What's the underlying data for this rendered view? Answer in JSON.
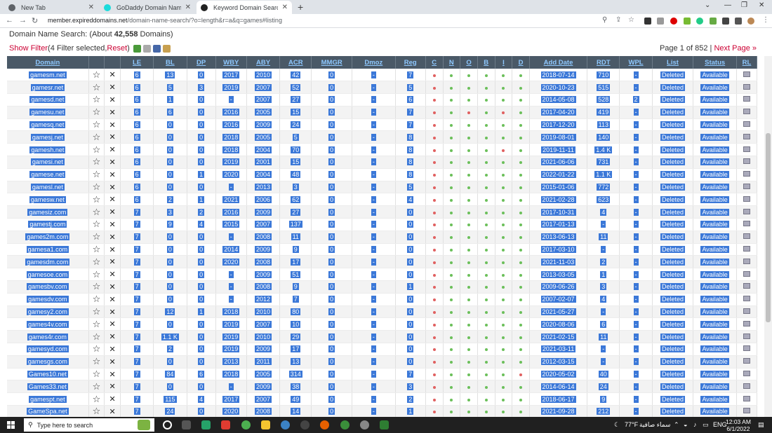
{
  "browser": {
    "tabs": [
      {
        "label": "New Tab",
        "favicon_color": "#5f6368",
        "active": false
      },
      {
        "label": "GoDaddy Domain Name Search",
        "favicon_color": "#1bdbdb",
        "active": false
      },
      {
        "label": "Keyword Domain Search » Expire",
        "favicon_color": "#222222",
        "active": true
      }
    ],
    "url_host": "member.expireddomains.net",
    "url_path": "/domain-name-search/?o=length&r=a&q=games#listing"
  },
  "page": {
    "search_label": "Domain Name Search: (About ",
    "count": "42,558",
    "count_suffix": " Domains)",
    "show_filter": "Show Filter",
    "filters_selected": " (4 Filter selected, ",
    "reset": "Reset",
    "reset_suffix": ")",
    "page_info": "Page 1 of 852 | ",
    "next_page": "Next Page »"
  },
  "table": {
    "headers": [
      "Domain",
      "",
      "",
      "LE",
      "BL",
      "DP",
      "WBY",
      "ABY",
      "ACR",
      "MMGR",
      "Dmoz",
      "Reg",
      "C",
      "N",
      "O",
      "B",
      "I",
      "D",
      "Add Date",
      "RDT",
      "WPL",
      "List",
      "Status",
      "RL"
    ],
    "rows": [
      [
        "gamesm.net",
        "6",
        "13",
        "0",
        "2017",
        "2010",
        "42",
        "0",
        "-",
        "7",
        "r",
        "g",
        "g",
        "g",
        "g",
        "g",
        "2018-07-14",
        "710",
        "-",
        "Deleted",
        "Available"
      ],
      [
        "gamesr.net",
        "6",
        "5",
        "3",
        "2019",
        "2007",
        "52",
        "0",
        "-",
        "5",
        "r",
        "g",
        "g",
        "g",
        "g",
        "g",
        "2020-10-23",
        "515",
        "-",
        "Deleted",
        "Available"
      ],
      [
        "gamesd.net",
        "6",
        "1",
        "0",
        "-",
        "2007",
        "27",
        "0",
        "-",
        "6",
        "r",
        "g",
        "g",
        "g",
        "g",
        "g",
        "2014-05-08",
        "528",
        "2",
        "Deleted",
        "Available"
      ],
      [
        "gamesu.net",
        "6",
        "6",
        "0",
        "2016",
        "2005",
        "15",
        "0",
        "-",
        "7",
        "r",
        "g",
        "r",
        "g",
        "r",
        "g",
        "2017-04-20",
        "419",
        "-",
        "Deleted",
        "Available"
      ],
      [
        "gamesq.net",
        "6",
        "0",
        "0",
        "2016",
        "2009",
        "24",
        "0",
        "-",
        "7",
        "r",
        "g",
        "g",
        "g",
        "g",
        "g",
        "2017-12-20",
        "113",
        "-",
        "Deleted",
        "Available"
      ],
      [
        "gamesj.net",
        "6",
        "0",
        "0",
        "2018",
        "2005",
        "5",
        "0",
        "-",
        "8",
        "r",
        "g",
        "g",
        "g",
        "g",
        "g",
        "2019-08-01",
        "140",
        "-",
        "Deleted",
        "Available"
      ],
      [
        "gamesh.net",
        "6",
        "0",
        "0",
        "2018",
        "2004",
        "70",
        "0",
        "-",
        "8",
        "r",
        "g",
        "g",
        "g",
        "r",
        "g",
        "2019-11-11",
        "1.4 K",
        "-",
        "Deleted",
        "Available"
      ],
      [
        "gamesi.net",
        "6",
        "0",
        "0",
        "2019",
        "2001",
        "15",
        "0",
        "-",
        "8",
        "r",
        "g",
        "g",
        "g",
        "g",
        "g",
        "2021-06-06",
        "731",
        "-",
        "Deleted",
        "Available"
      ],
      [
        "gamese.net",
        "6",
        "0",
        "1",
        "2020",
        "2004",
        "48",
        "0",
        "-",
        "8",
        "r",
        "g",
        "g",
        "g",
        "g",
        "g",
        "2022-01-22",
        "1.1 K",
        "-",
        "Deleted",
        "Available"
      ],
      [
        "gamesl.net",
        "6",
        "0",
        "0",
        "-",
        "2013",
        "3",
        "0",
        "-",
        "5",
        "r",
        "g",
        "g",
        "g",
        "g",
        "g",
        "2015-01-06",
        "772",
        "-",
        "Deleted",
        "Available"
      ],
      [
        "gamesw.net",
        "6",
        "2",
        "1",
        "2021",
        "2006",
        "62",
        "0",
        "-",
        "4",
        "r",
        "g",
        "g",
        "g",
        "g",
        "g",
        "2021-02-28",
        "623",
        "-",
        "Deleted",
        "Available"
      ],
      [
        "gamesiz.com",
        "7",
        "3",
        "2",
        "2016",
        "2009",
        "27",
        "0",
        "-",
        "0",
        "r",
        "g",
        "g",
        "g",
        "g",
        "g",
        "2017-10-31",
        "4",
        "-",
        "Deleted",
        "Available"
      ],
      [
        "gamestj.com",
        "7",
        "9",
        "4",
        "2015",
        "2007",
        "137",
        "0",
        "-",
        "0",
        "r",
        "g",
        "g",
        "g",
        "g",
        "g",
        "2017-01-13",
        "-",
        "-",
        "Deleted",
        "Available"
      ],
      [
        "games2m.com",
        "7",
        "0",
        "0",
        "-",
        "2008",
        "11",
        "0",
        "-",
        "0",
        "r",
        "g",
        "g",
        "g",
        "g",
        "g",
        "2013-06-13",
        "11",
        "-",
        "Deleted",
        "Available"
      ],
      [
        "gamesa1.com",
        "7",
        "0",
        "0",
        "2014",
        "2009",
        "9",
        "0",
        "-",
        "0",
        "r",
        "g",
        "g",
        "g",
        "g",
        "g",
        "2017-03-10",
        "-",
        "-",
        "Deleted",
        "Available"
      ],
      [
        "gamesdm.com",
        "7",
        "0",
        "0",
        "2020",
        "2008",
        "17",
        "0",
        "-",
        "0",
        "r",
        "g",
        "g",
        "g",
        "g",
        "g",
        "2021-11-03",
        "2",
        "-",
        "Deleted",
        "Available"
      ],
      [
        "gamesoe.com",
        "7",
        "0",
        "0",
        "-",
        "2009",
        "51",
        "0",
        "-",
        "0",
        "r",
        "g",
        "g",
        "g",
        "g",
        "g",
        "2013-03-05",
        "1",
        "-",
        "Deleted",
        "Available"
      ],
      [
        "gamesbv.com",
        "7",
        "0",
        "0",
        "-",
        "2008",
        "9",
        "0",
        "-",
        "1",
        "r",
        "g",
        "g",
        "g",
        "g",
        "g",
        "2009-06-26",
        "3",
        "-",
        "Deleted",
        "Available"
      ],
      [
        "gamesdv.com",
        "7",
        "0",
        "0",
        "-",
        "2012",
        "7",
        "0",
        "-",
        "0",
        "r",
        "g",
        "g",
        "g",
        "g",
        "g",
        "2007-02-07",
        "4",
        "-",
        "Deleted",
        "Available"
      ],
      [
        "gamesy2.com",
        "7",
        "12",
        "1",
        "2018",
        "2010",
        "80",
        "0",
        "-",
        "0",
        "r",
        "g",
        "g",
        "g",
        "g",
        "g",
        "2021-05-27",
        "-",
        "-",
        "Deleted",
        "Available"
      ],
      [
        "games4v.com",
        "7",
        "0",
        "0",
        "2019",
        "2007",
        "10",
        "0",
        "-",
        "0",
        "r",
        "g",
        "g",
        "g",
        "g",
        "g",
        "2020-08-06",
        "6",
        "-",
        "Deleted",
        "Available"
      ],
      [
        "games4r.com",
        "7",
        "1.1 K",
        "0",
        "2019",
        "2010",
        "29",
        "0",
        "-",
        "0",
        "r",
        "g",
        "g",
        "g",
        "g",
        "g",
        "2021-02-15",
        "11",
        "-",
        "Deleted",
        "Available"
      ],
      [
        "gamesyd.com",
        "7",
        "2",
        "0",
        "2019",
        "2009",
        "17",
        "0",
        "-",
        "0",
        "r",
        "g",
        "g",
        "g",
        "g",
        "g",
        "2021-03-11",
        "-",
        "-",
        "Deleted",
        "Available"
      ],
      [
        "gamesgs.com",
        "7",
        "0",
        "0",
        "2013",
        "2011",
        "13",
        "0",
        "-",
        "0",
        "r",
        "g",
        "g",
        "g",
        "g",
        "g",
        "2012-03-15",
        "-",
        "-",
        "Deleted",
        "Available"
      ],
      [
        "Games10.net",
        "7",
        "84",
        "6",
        "2018",
        "2005",
        "314",
        "0",
        "-",
        "7",
        "r",
        "g",
        "g",
        "g",
        "g",
        "r",
        "2020-05-02",
        "40",
        "-",
        "Deleted",
        "Available"
      ],
      [
        "Games33.net",
        "7",
        "0",
        "0",
        "-",
        "2009",
        "38",
        "0",
        "-",
        "3",
        "r",
        "g",
        "g",
        "g",
        "g",
        "g",
        "2014-06-14",
        "24",
        "-",
        "Deleted",
        "Available"
      ],
      [
        "gamespt.net",
        "7",
        "115",
        "4",
        "2017",
        "2007",
        "49",
        "0",
        "-",
        "2",
        "r",
        "g",
        "g",
        "g",
        "g",
        "g",
        "2018-06-17",
        "9",
        "-",
        "Deleted",
        "Available"
      ],
      [
        "GameSpa.net",
        "7",
        "24",
        "0",
        "2020",
        "2008",
        "14",
        "0",
        "-",
        "1",
        "r",
        "g",
        "g",
        "g",
        "g",
        "g",
        "2021-09-28",
        "212",
        "-",
        "Deleted",
        "Available"
      ]
    ]
  },
  "taskbar": {
    "search_placeholder": "Type here to search",
    "weather": "77°F",
    "weather_text": "سماء صافية",
    "lang": "ENG",
    "time": "12:03 AM",
    "date": "6/1/2022"
  },
  "colors": {
    "header_bg": "#4a5967",
    "header_link": "#8ec8ff",
    "highlight": "#3b78d8",
    "accent_red": "#cc0033",
    "dot_green": "#6bbf5a",
    "dot_red": "#e06060"
  }
}
